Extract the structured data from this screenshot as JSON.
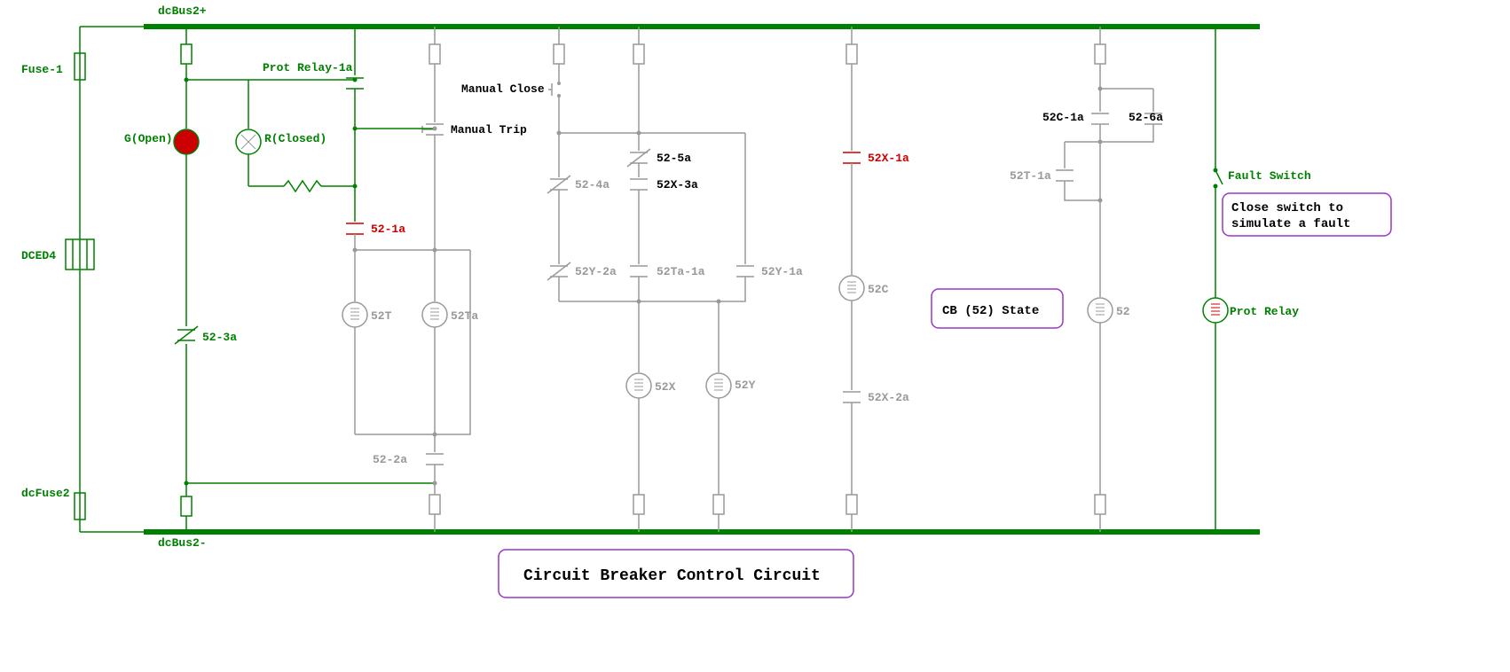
{
  "title": "Circuit Breaker Control Circuit",
  "buses": {
    "top": "dcBus2+",
    "bottom": "dcBus2-"
  },
  "leftside": {
    "fuse1": "Fuse-1",
    "dced4": "DCED4",
    "dcfuse2": "dcFuse2"
  },
  "lamps": {
    "green": "G(Open)",
    "red": "R(Closed)"
  },
  "labels": {
    "prot_relay_1a": "Prot Relay-1a",
    "manual_close": "Manual Close",
    "manual_trip": "Manual Trip",
    "l52_1a": "52-1a",
    "l52_2a": "52-2a",
    "l52_3a": "52-3a",
    "l52_4a": "52-4a",
    "l52_5a": "52-5a",
    "l52_6a": "52-6a",
    "l52X_1a": "52X-1a",
    "l52X_2a": "52X-2a",
    "l52X_3a": "52X-3a",
    "l52Y_1a": "52Y-1a",
    "l52Y_2a": "52Y-2a",
    "l52C_1a": "52C-1a",
    "l52T_1a": "52T-1a",
    "l52Ta_1a": "52Ta-1a",
    "coil_52T": "52T",
    "coil_52Ta": "52Ta",
    "coil_52X": "52X",
    "coil_52Y": "52Y",
    "coil_52C": "52C",
    "coil_52": "52",
    "fault_switch": "Fault Switch",
    "prot_relay": "Prot Relay"
  },
  "boxes": {
    "cb_state": "CB (52) State",
    "fault_note_l1": "Close switch to",
    "fault_note_l2": "simulate a fault"
  }
}
